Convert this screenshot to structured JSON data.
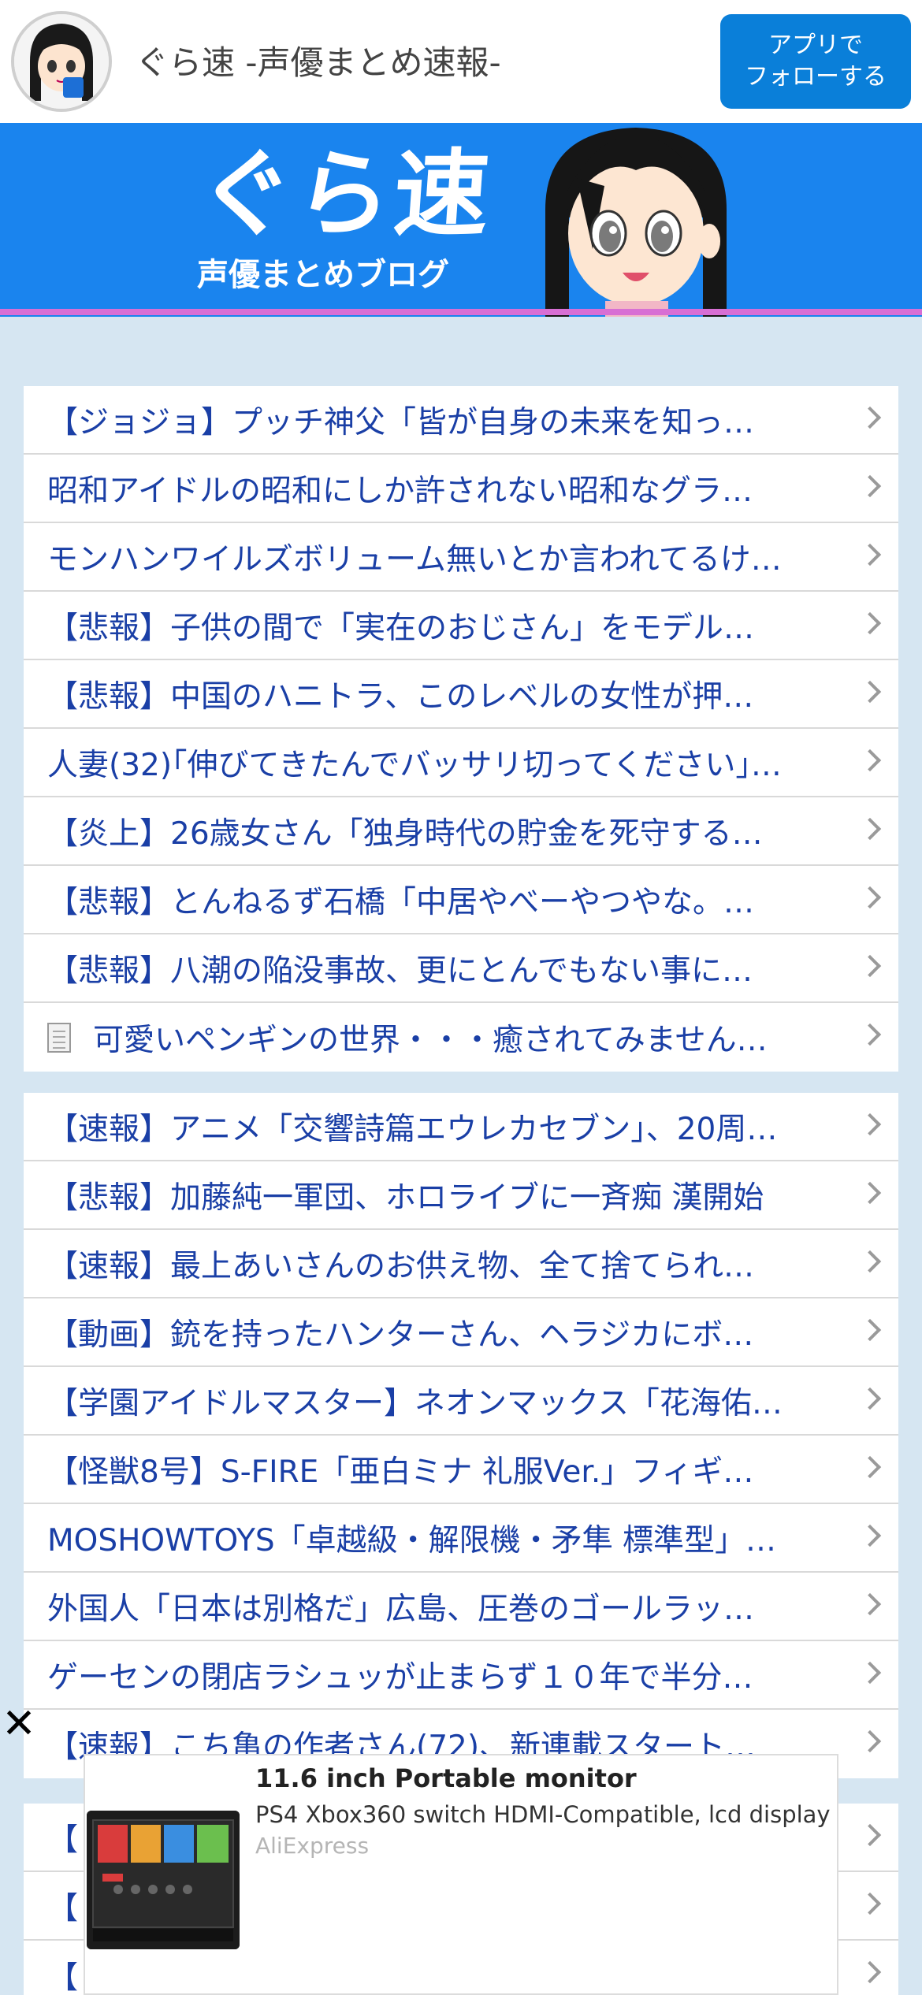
{
  "header": {
    "site_title": "ぐら速 -声優まとめ速報-",
    "follow_line1": "アプリで",
    "follow_line2": "フォローする"
  },
  "banner": {
    "logo_text": "ぐら速",
    "subtitle": "声優まとめブログ"
  },
  "list1": [
    {
      "label": "【ジョジョ】プッチ神父「皆が自身の未来を知っ…"
    },
    {
      "label": "昭和アイドルの昭和にしか許されない昭和なグラ…"
    },
    {
      "label": "モンハンワイルズボリューム無いとか言われてるけ…"
    },
    {
      "label": "【悲報】子供の間で「実在のおじさん」をモデル…"
    },
    {
      "label": "【悲報】中国のハニトラ、このレベルの女性が押…"
    },
    {
      "label": "人妻(32)｢伸びてきたんでバッサリ切ってください｣…"
    },
    {
      "label": "【炎上】26歳女さん「独身時代の貯金を死守する…"
    },
    {
      "label": "【悲報】とんねるず石橋「中居やべーやつやな。…"
    },
    {
      "label": "【悲報】八潮の陥没事故、更にとんでもない事に…"
    },
    {
      "label": "可愛いペンギンの世界・・・癒されてみません…",
      "icon": "document-icon"
    }
  ],
  "list2": [
    {
      "label": "【速報】アニメ「交響詩篇エウレカセブン」、20周…"
    },
    {
      "label": "【悲報】加藤純一軍団、ホロライブに一斉痴 漢開始"
    },
    {
      "label": "【速報】最上あいさんのお供え物、全て捨てられ…"
    },
    {
      "label": "【動画】銃を持ったハンターさん、ヘラジカにボ…"
    },
    {
      "label": "【学園アイドルマスター】ネオンマックス「花海佑…"
    },
    {
      "label": "【怪獣8号】S-FIRE「亜白ミナ 礼服Ver.」フィギ…"
    },
    {
      "label": "MOSHOWTOYS「卓越級・解限機・矛隼 標準型」…"
    },
    {
      "label": "外国人「日本は別格だ」広島、圧巻のゴールラッ…"
    },
    {
      "label": "ゲーセンの閉店ラシュッが止まらず１０年で半分…"
    },
    {
      "label": "【速報】こち亀の作者さん(72)、新連載スタート…"
    }
  ],
  "list3": [
    {
      "label": "【"
    },
    {
      "label": "【"
    },
    {
      "label": "【"
    }
  ],
  "ad": {
    "close_symbol": "✕",
    "title": "11.6 inch Portable monitor",
    "description": "PS4 Xbox360 switch HDMI-Compatible, lcd display",
    "source": "AliExpress"
  },
  "colors": {
    "link": "#1a3fa6",
    "banner": "#1a84ee",
    "button": "#0a7fd9",
    "background": "#d6e6f2"
  }
}
